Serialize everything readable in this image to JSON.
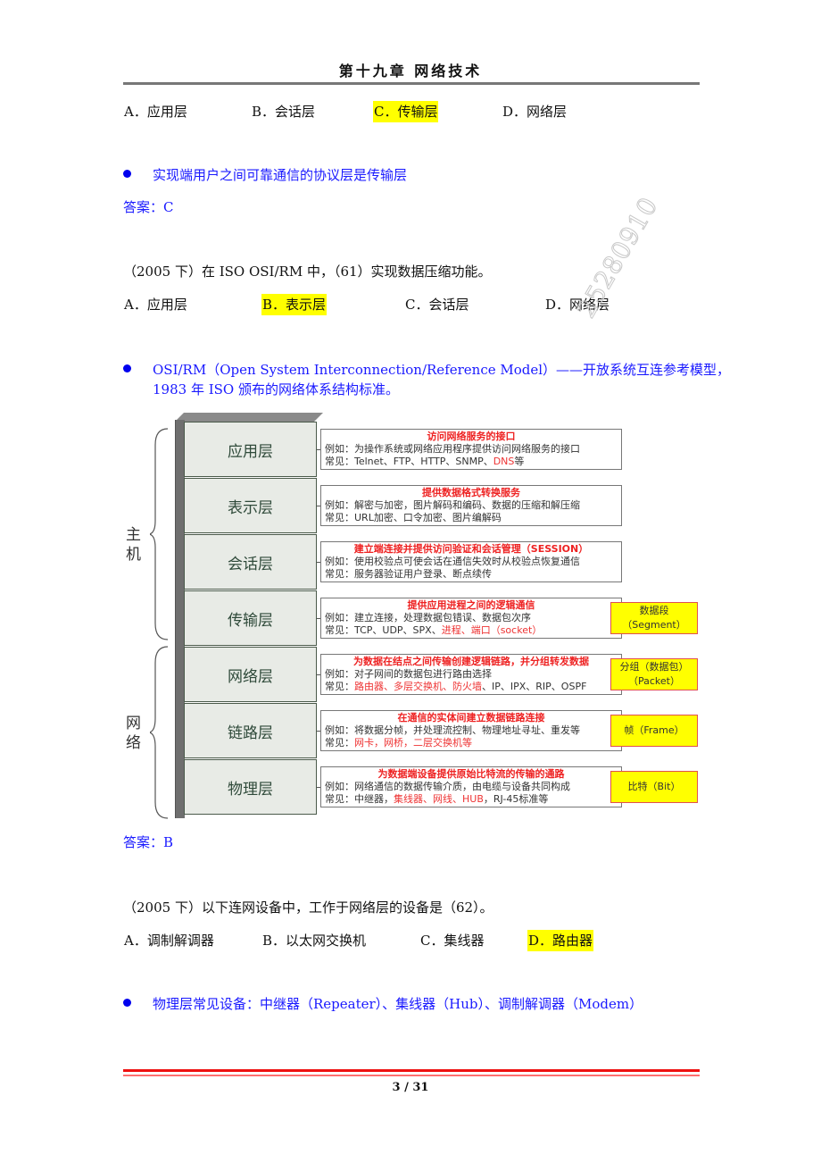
{
  "header": {
    "title": "第十九章  网络技术"
  },
  "q1_options": [
    {
      "label": "A．应用层",
      "highlighted": false
    },
    {
      "label": "B．会话层",
      "highlighted": false
    },
    {
      "label": "C．传输层",
      "highlighted": true
    },
    {
      "label": "D．网络层",
      "highlighted": false
    }
  ],
  "note1": "实现端用户之间可靠通信的协议层是传输层",
  "answer1": "答案：C",
  "q2": {
    "text": "（2005 下）在 ISO OSI/RM 中，（61）实现数据压缩功能。",
    "options": [
      {
        "label": "A．应用层",
        "highlighted": false
      },
      {
        "label": "B．表示层",
        "highlighted": true
      },
      {
        "label": "C．会话层",
        "highlighted": false
      },
      {
        "label": "D．网络层",
        "highlighted": false
      }
    ]
  },
  "note2": {
    "line1": "OSI/RM（Open System Interconnection/Reference Model）——开放系统互连参考模型，",
    "line2": "1983 年 ISO 颁布的网络体系结构标准。"
  },
  "watermark": "25280910",
  "diagram": {
    "group_host": "主机",
    "group_network": "网络",
    "layers": [
      {
        "name": "应用层",
        "title": "访问网络服务的接口",
        "example": "例如：为操作系统或网络应用程序提供访问网络服务的接口",
        "common_prefix": "常见：Telnet、FTP、HTTP、SNMP、",
        "common_red": "DNS",
        "common_suffix": "等"
      },
      {
        "name": "表示层",
        "title": "提供数据格式转换服务",
        "example": "例如：解密与加密，图片解码和编码、数据的压缩和解压缩",
        "common_prefix": "常见：URL加密、口令加密、图片编解码",
        "common_red": "",
        "common_suffix": ""
      },
      {
        "name": "会话层",
        "title": "建立端连接并提供访问验证和会话管理（SESSION）",
        "example": "例如：使用校验点可使会话在通信失效时从校验点恢复通信",
        "common_prefix": "常见：服务器验证用户登录、断点续传",
        "common_red": "",
        "common_suffix": ""
      },
      {
        "name": "传输层",
        "title": "提供应用进程之间的逻辑通信",
        "example": "例如：建立连接，处理数据包错误、数据包次序",
        "common_prefix": "常见：TCP、UDP、SPX、",
        "common_red": "进程、端口（socket）",
        "common_suffix": "",
        "pdu": [
          "数据段",
          "（Segment）"
        ]
      },
      {
        "name": "网络层",
        "title": "为数据在结点之间传输创建逻辑链路，并分组转发数据",
        "example": "例如：对子网间的数据包进行路由选择",
        "common_prefix": "常见：",
        "common_red": "路由器、多层交换机、防火墙",
        "common_suffix": "、IP、IPX、RIP、OSPF",
        "pdu": [
          "分组（数据包）",
          "（Packet）"
        ]
      },
      {
        "name": "链路层",
        "title": "在通信的实体间建立数据链路连接",
        "example": "例如：将数据分帧，并处理流控制、物理地址寻址、重发等",
        "common_prefix": "常见：",
        "common_red": "网卡，网桥，二层交换机等",
        "common_suffix": "",
        "pdu": [
          "帧（Frame）"
        ]
      },
      {
        "name": "物理层",
        "title": "为数据端设备提供原始比特流的传输的通路",
        "example": "例如：网络通信的数据传输介质，由电缆与设备共同构成",
        "common_prefix": "常见：中继器，",
        "common_red": "集线器、网线、HUB",
        "common_suffix": "，RJ-45标准等",
        "pdu": [
          "比特（Bit）"
        ]
      }
    ]
  },
  "answer2": "答案：B",
  "q3": {
    "text": "（2005 下）以下连网设备中，工作于网络层的设备是（62）。",
    "options": [
      {
        "label": "A．调制解调器",
        "highlighted": false
      },
      {
        "label": "B．以太网交换机",
        "highlighted": false
      },
      {
        "label": "C．集线器",
        "highlighted": false
      },
      {
        "label": "D．路由器",
        "highlighted": true
      }
    ]
  },
  "note3": "物理层常见设备：中继器（Repeater）、集线器（Hub）、调制解调器（Modem）",
  "footer": {
    "page": "3 / 31"
  }
}
